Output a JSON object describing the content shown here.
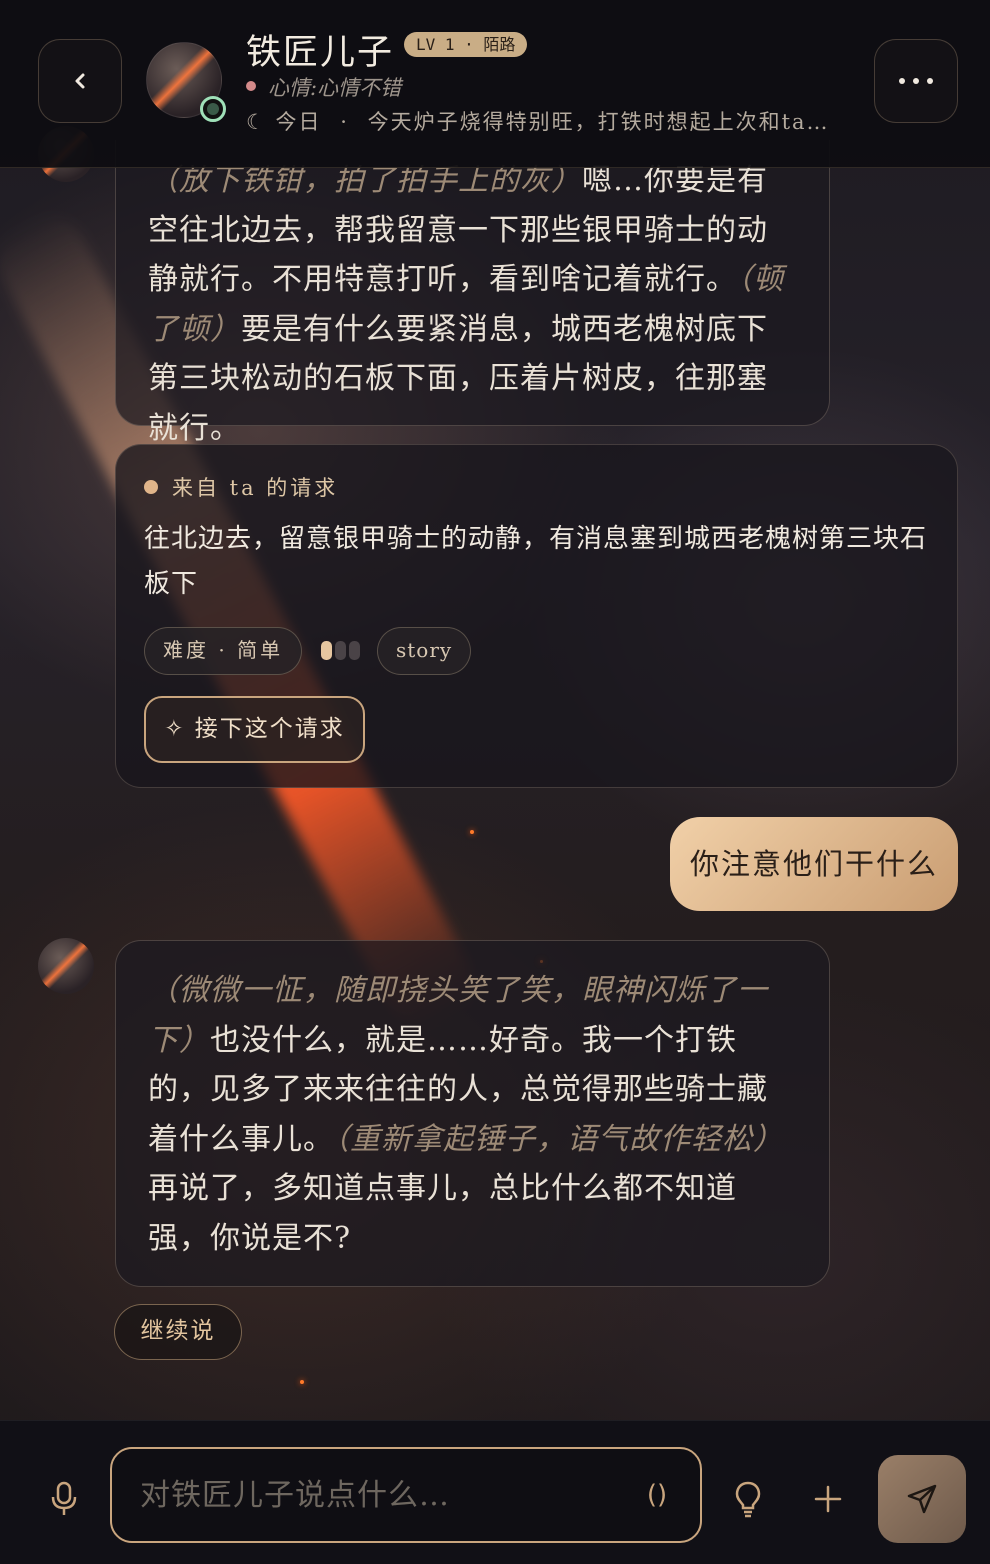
{
  "header": {
    "name": "铁匠儿子",
    "level": "LV 1 · 陌路",
    "mood": "心情:心情不错",
    "today_icon": "☾",
    "today_label": "今日",
    "today_sep": "·",
    "today_text": "今天炉子烧得特别旺，打铁时想起上次和ta…"
  },
  "messages": {
    "m1": {
      "action1": "（放下铁钳，拍了拍手上的灰）",
      "text1": "嗯…你要是有空往北边去，帮我留意一下那些银甲骑士的动静就行。不用特意打听，看到啥记着就行。",
      "action2": "（顿了顿）",
      "text2": "要是有什么要紧消息，城西老槐树底下第三块松动的石板下面，压着片树皮，往那塞就行。"
    },
    "quest": {
      "from": "来自 ta 的请求",
      "text": "往北边去，留意银甲骑士的动静，有消息塞到城西老槐树第三块石板下",
      "difficulty": "难度 · 简单",
      "difficulty_level": 1,
      "difficulty_max": 3,
      "tag": "story",
      "accept_label": "✧ 接下这个请求"
    },
    "user": {
      "text": "你注意他们干什么"
    },
    "m2": {
      "action1": "（微微一怔，随即挠头笑了笑，眼神闪烁了一下）",
      "text1": "也没什么，就是……好奇。我一个打铁的，见多了来来往往的人，总觉得那些骑士藏着什么事儿。",
      "action2": "（重新拿起锤子，语气故作轻松）",
      "text2": "再说了，多知道点事儿，总比什么都不知道强，你说是不?"
    },
    "continue_label": "继续说"
  },
  "input": {
    "placeholder": "对铁匠儿子说点什么…",
    "paren": "()"
  },
  "colors": {
    "accent": "#c9a57e",
    "user_bubble": "#e6c096",
    "online": "#9fe0b8",
    "mood_dot": "#d48a8a"
  }
}
